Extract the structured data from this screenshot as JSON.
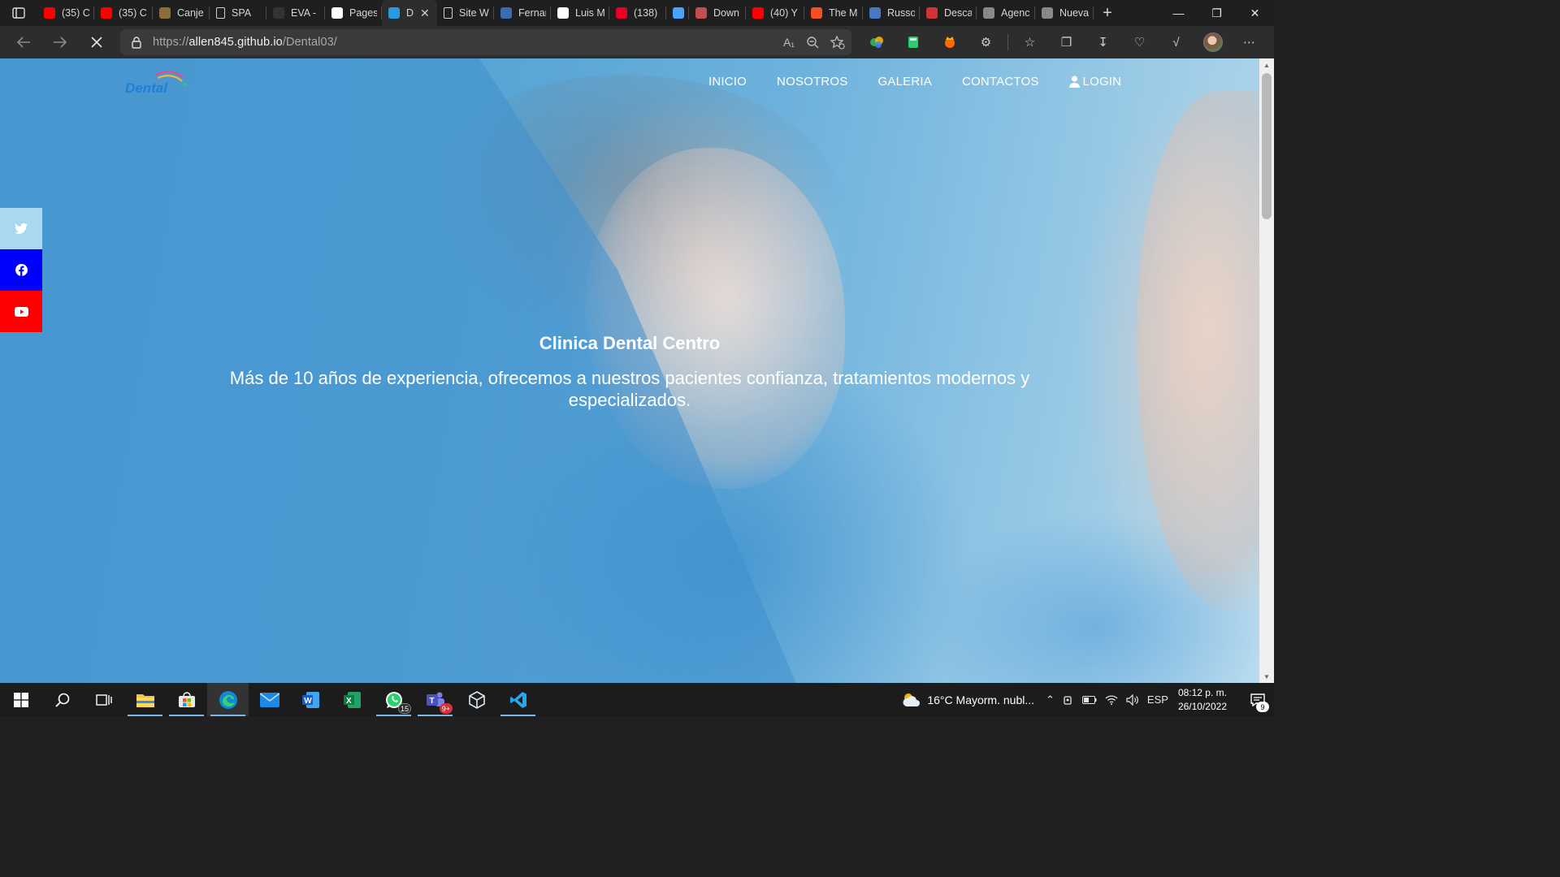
{
  "browser": {
    "tabs": [
      {
        "label": "(35) C",
        "icon": "youtube-icon",
        "color": "#ff0000"
      },
      {
        "label": "(35) C",
        "icon": "youtube-icon",
        "color": "#ff0000"
      },
      {
        "label": "Canje",
        "icon": "medal-icon",
        "color": "#8a6d3b"
      },
      {
        "label": "SPA",
        "icon": "document-icon",
        "color": ""
      },
      {
        "label": "EVA -",
        "icon": "blank-icon",
        "color": "#333333"
      },
      {
        "label": "Pages",
        "icon": "github-icon",
        "color": "#ffffff"
      },
      {
        "label": "D",
        "icon": "dental-icon",
        "color": "#2a9be0"
      },
      {
        "label": "Site W",
        "icon": "document-icon",
        "color": ""
      },
      {
        "label": "Fernar",
        "icon": "globe-icon",
        "color": "#3b6bb3"
      },
      {
        "label": "Luis M",
        "icon": "person-icon",
        "color": "#ffffff"
      },
      {
        "label": "(138)",
        "icon": "pinterest-icon",
        "color": "#e60023"
      },
      {
        "label": "",
        "icon": "phone-icon",
        "color": "#4aa3ff"
      },
      {
        "label": "Down",
        "icon": "download-site-icon",
        "color": "#c0504d"
      },
      {
        "label": "(40) Y",
        "icon": "youtube-icon",
        "color": "#ff0000"
      },
      {
        "label": "The M",
        "icon": "microsoft-icon",
        "color": "#f25022"
      },
      {
        "label": "Russo",
        "icon": "russo-icon",
        "color": "#4a78c2"
      },
      {
        "label": "Desca",
        "icon": "opera-icon",
        "color": "#d13438"
      },
      {
        "label": "Agenc",
        "icon": "hat-icon",
        "color": "#888888"
      },
      {
        "label": "Nueva",
        "icon": "newtab-icon",
        "color": "#888888"
      }
    ],
    "active_tab_index": 6,
    "address": {
      "scheme": "https://",
      "host": "allen845.github.io",
      "path": "/Dental03/"
    }
  },
  "site": {
    "logo_text": "Dental",
    "nav": [
      "INICIO",
      "NOSOTROS",
      "GALERIA",
      "CONTACTOS",
      "LOGIN"
    ],
    "hero_title": "Clinica Dental Centro",
    "hero_subtitle": "Más de 10 años de experiencia, ofrecemos a nuestros pacientes confianza, tratamientos modernos y especializados.",
    "social_colors": {
      "twitter": "#a9d8f0",
      "facebook": "#0000ff",
      "youtube": "#ff0000"
    }
  },
  "taskbar": {
    "apps": [
      {
        "name": "file-explorer",
        "running": true
      },
      {
        "name": "microsoft-store",
        "running": true
      },
      {
        "name": "edge",
        "running": true,
        "active": true
      },
      {
        "name": "mail",
        "running": false
      },
      {
        "name": "word",
        "running": false
      },
      {
        "name": "excel",
        "running": false
      },
      {
        "name": "whatsapp",
        "running": true,
        "badge": "15"
      },
      {
        "name": "teams",
        "running": true,
        "badge": "9+"
      },
      {
        "name": "virtualbox",
        "running": false
      },
      {
        "name": "vscode",
        "running": true
      }
    ],
    "weather": "16°C  Mayorm. nubl...",
    "language": "ESP",
    "time": "08:12 p. m.",
    "date": "26/10/2022",
    "notifications": "9"
  }
}
